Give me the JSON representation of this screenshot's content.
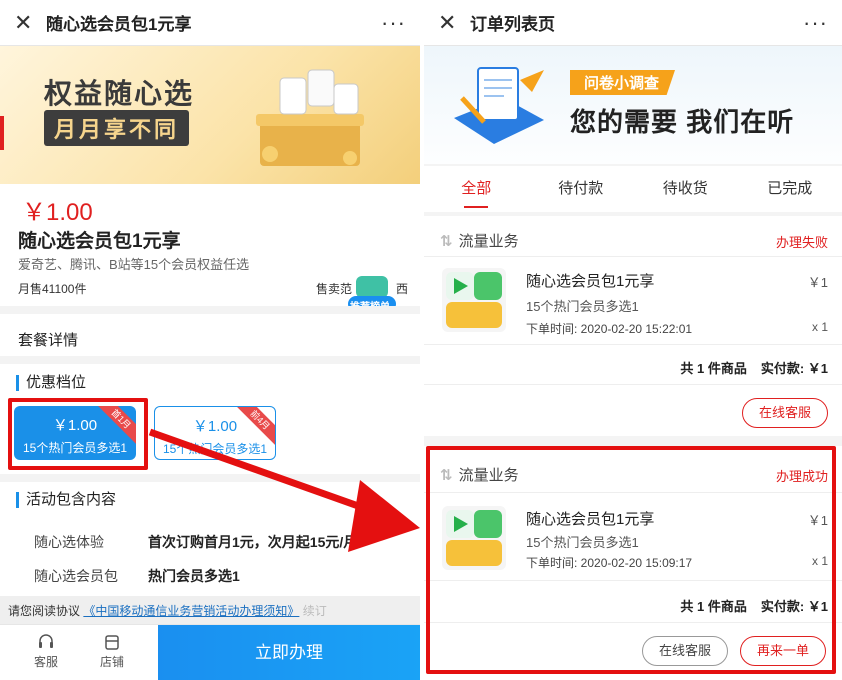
{
  "left": {
    "titlebar": {
      "close": "✕",
      "title": "随心选会员包1元享",
      "more": "···"
    },
    "banner": {
      "line1": "权益随心选",
      "line2": "月月享不同"
    },
    "product": {
      "price": "￥1.00",
      "name": "随心选会员包1元享",
      "desc": "爱奇艺、腾讯、B站等15个会员权益任选",
      "sales": "月售41100件",
      "seller": "售卖范",
      "seller_tail": "西",
      "rec_badge": "推荐榜单"
    },
    "package_detail": "套餐详情",
    "discount_title": "优惠档位",
    "tiers": [
      {
        "price": "￥1.00",
        "desc": "15个热门会员多选1",
        "ribbon": "首1月",
        "active": true
      },
      {
        "price": "￥1.00",
        "desc": "15个热门会员多选1",
        "ribbon": "前4月",
        "active": false
      }
    ],
    "activity_title": "活动包含内容",
    "activity_rows": [
      {
        "key": "随心选体验",
        "value": "首次订购首月1元，次月起15元/月"
      },
      {
        "key": "随心选会员包",
        "value": "热门会员多选1"
      }
    ],
    "agreement": {
      "prefix": "请您阅读协议",
      "link": "《中国移动通信业务营销活动办理须知》",
      "suffix": "续订"
    },
    "bottom": {
      "service": "客服",
      "shop": "店铺",
      "buy": "立即办理"
    }
  },
  "right": {
    "titlebar": {
      "close": "✕",
      "title": "订单列表页",
      "more": "···"
    },
    "banner": {
      "tag": "问卷小调查",
      "main": "您的需要 我们在听"
    },
    "tabs": [
      "全部",
      "待付款",
      "待收货",
      "已完成"
    ],
    "orders": [
      {
        "category": "流量业务",
        "status": "办理失败",
        "name": "随心选会员包1元享",
        "desc": "15个热门会员多选1",
        "time": "下单时间: 2020-02-20 15:22:01",
        "price": "￥1",
        "qty": "x 1",
        "count": "共 1 件商品",
        "paid": "实付款: ￥1",
        "buttons": [
          "在线客服"
        ]
      },
      {
        "category": "流量业务",
        "status": "办理成功",
        "name": "随心选会员包1元享",
        "desc": "15个热门会员多选1",
        "time": "下单时间: 2020-02-20 15:09:17",
        "price": "￥1",
        "qty": "x 1",
        "count": "共 1 件商品",
        "paid": "实付款: ￥1",
        "buttons": [
          "在线客服",
          "再来一单"
        ]
      }
    ]
  },
  "colors": {
    "accent_blue": "#1a90e8",
    "accent_red": "#e02020",
    "highlight": "#e41010"
  }
}
